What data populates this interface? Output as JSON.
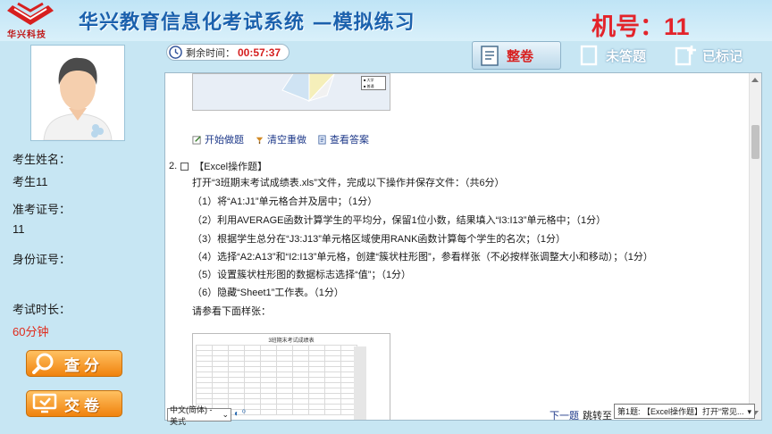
{
  "header": {
    "logo_text": "华兴科技",
    "system_title": "华兴教育信息化考试系统 —模拟练习",
    "machine_no": "机号：11"
  },
  "candidate": {
    "name_label": "考生姓名：",
    "name_value": "考生11",
    "id_label": "准考证号：",
    "id_value": "11",
    "idcard_label": "身份证号：",
    "idcard_value": "",
    "duration_label": "考试时长：",
    "duration_value": "60分钟"
  },
  "side_buttons": {
    "score_label": "查分",
    "submit_label": "交卷"
  },
  "timer": {
    "label": "剩余时间：",
    "value": "00:57:37"
  },
  "view_tabs": [
    {
      "label": "整卷",
      "icon": "document-icon",
      "active": true
    },
    {
      "label": "未答题",
      "icon": "blank-page-icon",
      "active": false
    },
    {
      "label": "已标记",
      "icon": "bookmark-plus-icon",
      "active": false
    }
  ],
  "actions": {
    "start": "开始做题",
    "clear": "清空重做",
    "answer": "查看答案"
  },
  "question": {
    "number": "2.",
    "type": "【Excel操作题】",
    "lines": [
      "打开“3班期末考试成绩表.xls”文件，完成以下操作并保存文件：（共6分）",
      "（1）将“A1:J1”单元格合并及居中；（1分）",
      "（2）利用AVERAGE函数计算学生的平均分，保留1位小数，结果填入“I3:I13”单元格中；（1分）",
      "（3）根据学生总分在“J3:J13”单元格区域使用RANK函数计算每个学生的名次；（1分）",
      "（4）选择“A2:A13”和“I2:I13”单元格，创建“簇状柱形图”，参看样张（不必按样张调整大小和移动）；（1分）",
      "（5）设置簇状柱形图的数据标志选择“值”；（1分）",
      "（6）隐藏“Sheet1”工作表。（1分）",
      "请参看下面样张："
    ]
  },
  "sample": {
    "title": "3班期末考试成绩表",
    "legend": [
      "■ 大学",
      "■ 普通"
    ]
  },
  "bottom": {
    "ime_text": "中文(简体) - 美式",
    "next_label": "下一题",
    "jump_label": "跳转至",
    "jump_value": "第1题: 【Excel操作题】打开“常见..."
  },
  "colors": {
    "title_blue": "#1b61ad",
    "alert_red": "#e3242b",
    "button_orange": "#f0820d",
    "background": "#c7e6f3"
  }
}
